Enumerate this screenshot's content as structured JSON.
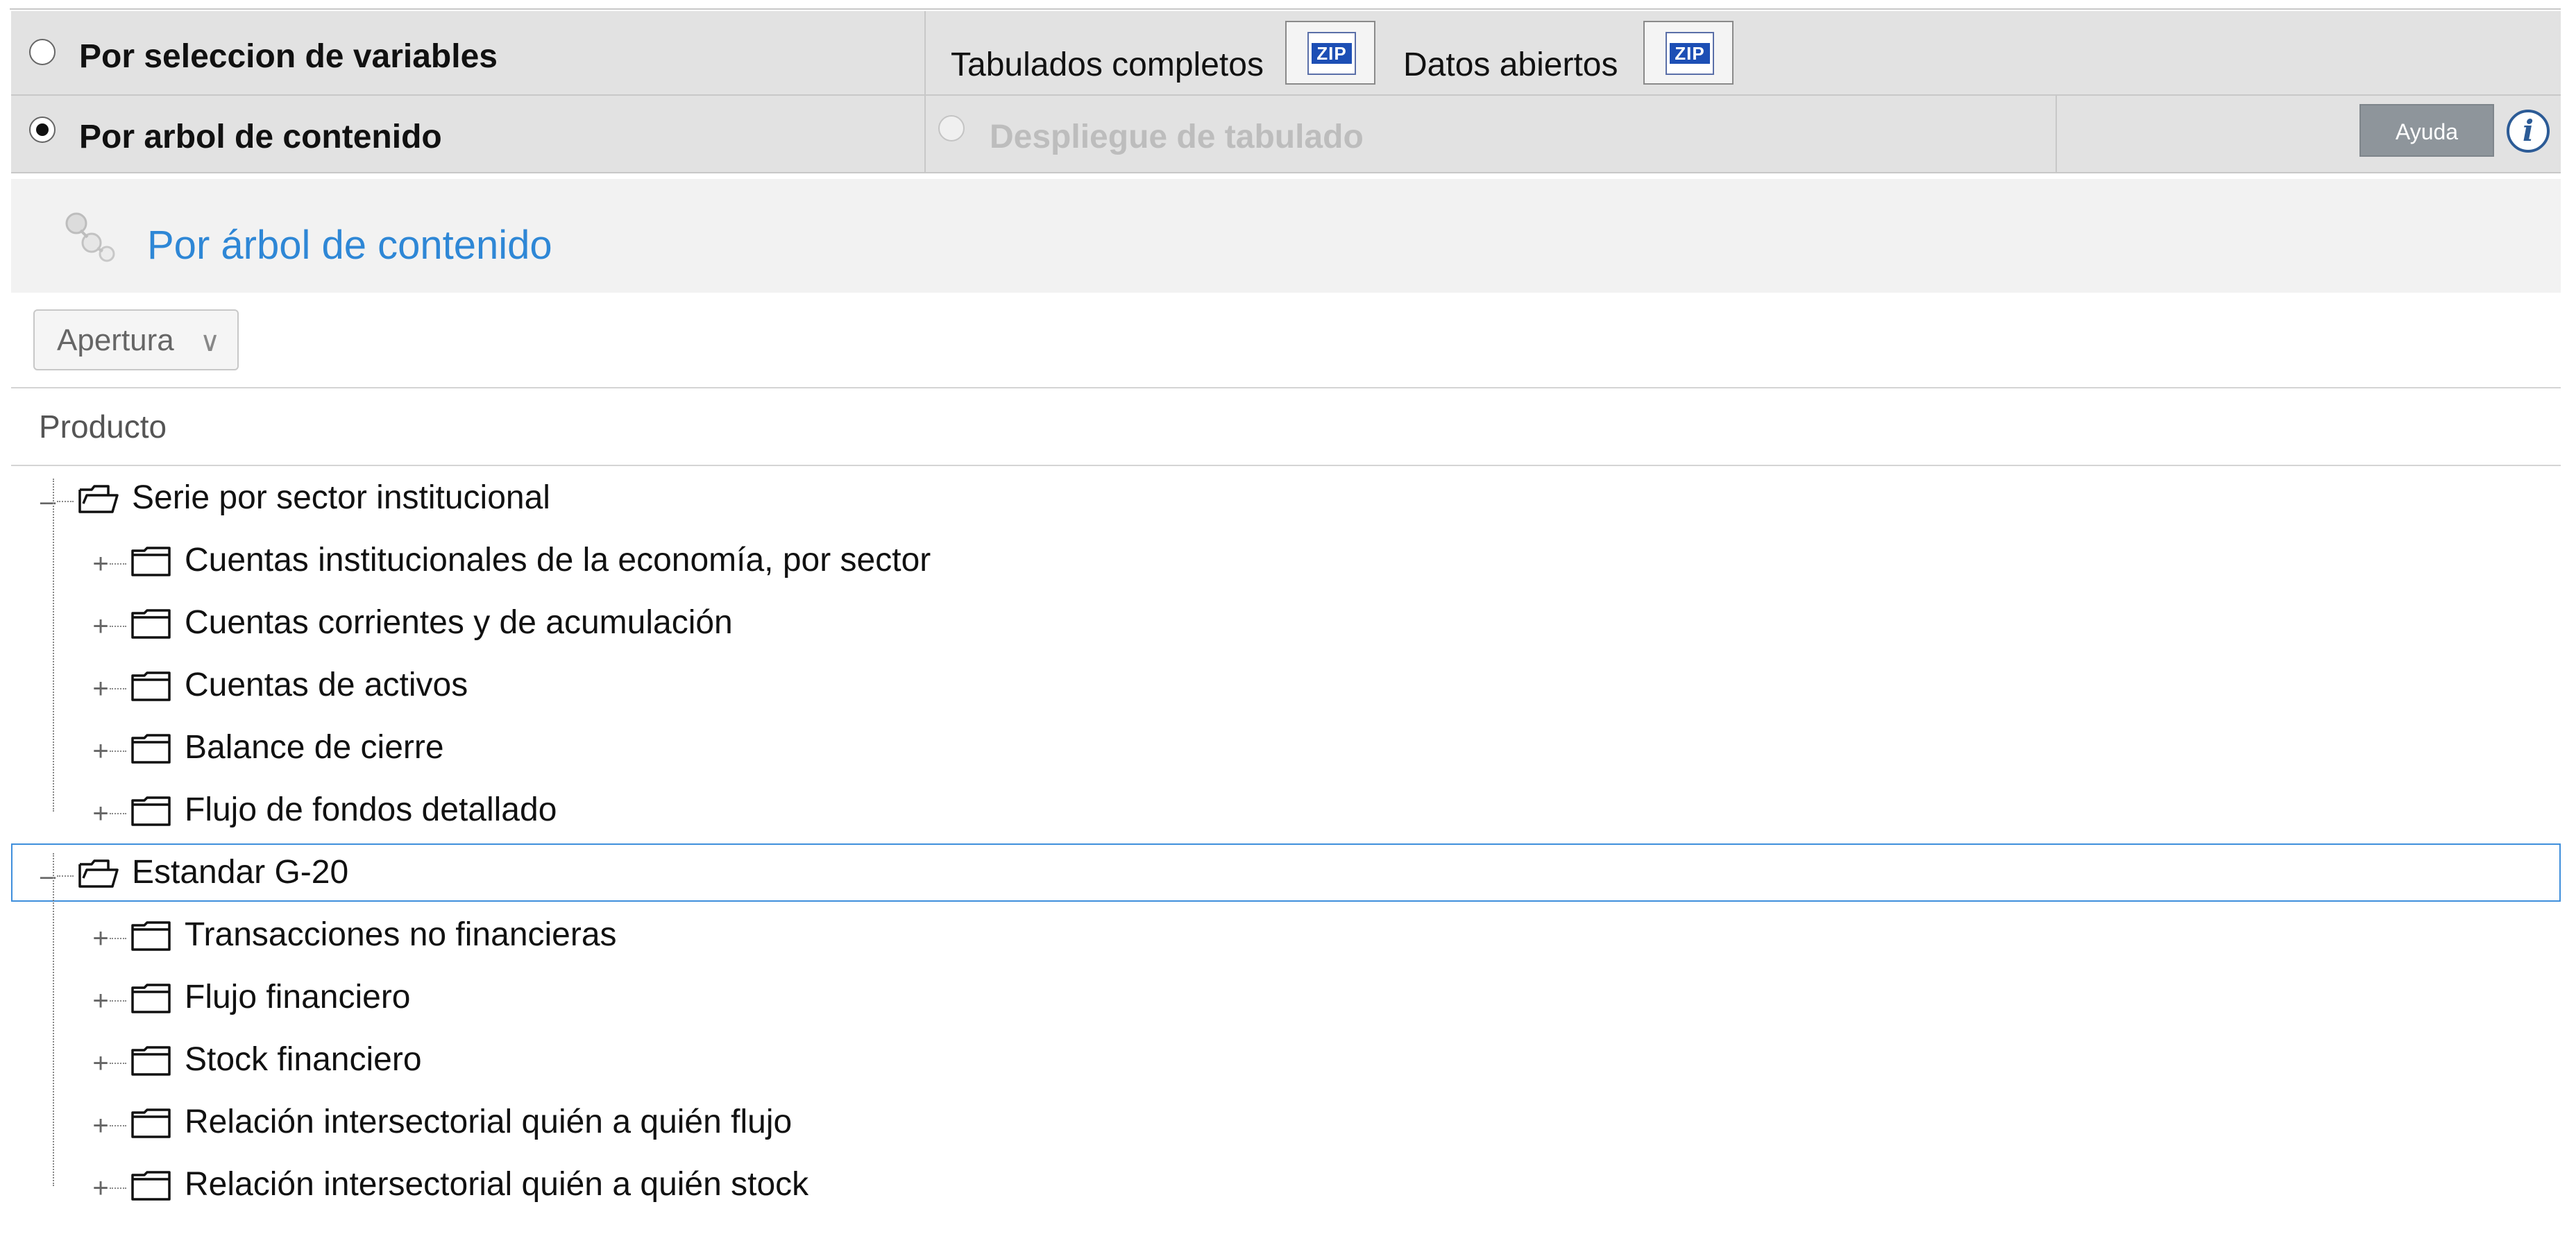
{
  "options": {
    "por_seleccion_label": "Por seleccion de variables",
    "por_arbol_label": "Por arbol de contenido",
    "despliegue_label": "Despliegue de tabulado",
    "tabulados_label": "Tabulados completos",
    "datos_abiertos_label": "Datos abiertos",
    "zip_text": "ZIP",
    "ayuda_label": "Ayuda",
    "info_glyph": "i",
    "selected": "Por arbol de contenido"
  },
  "content": {
    "title": "Por árbol de contenido",
    "apertura_label": "Apertura",
    "apertura_chevron": "∨",
    "column_header": "Producto"
  },
  "tree": {
    "groups": [
      {
        "label": "Serie por sector institucional",
        "expanded": true,
        "children": [
          "Cuentas institucionales de la economía, por sector",
          "Cuentas corrientes y de acumulación",
          "Cuentas de activos",
          "Balance de cierre",
          "Flujo de fondos detallado"
        ]
      },
      {
        "label": "Estandar G-20",
        "expanded": true,
        "selected": true,
        "children": [
          "Transacciones no financieras",
          "Flujo financiero",
          "Stock financiero",
          "Relación intersectorial quién a quién flujo",
          "Relación intersectorial quién a quién stock"
        ]
      }
    ]
  },
  "colors": {
    "link_blue": "#2e87d6",
    "option_bg": "#e2e2e2",
    "selection_border": "#3f8fdc",
    "ayuda_bg": "#8e959b",
    "zip_blue": "#1d4fb5"
  },
  "icons": [
    "zip-icon",
    "info-icon",
    "tree-logo-icon",
    "folder-open-icon",
    "folder-closed-icon",
    "chevron-down-icon"
  ]
}
